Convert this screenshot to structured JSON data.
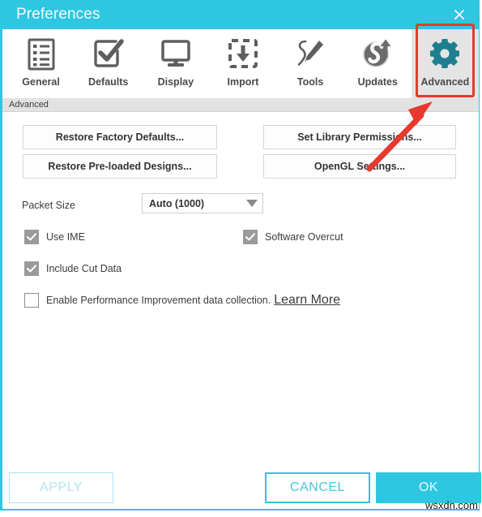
{
  "window": {
    "title": "Preferences",
    "close_icon": "close-icon",
    "accent_color": "#2ec6e0",
    "annotation_color": "#e8392f"
  },
  "toolbar": {
    "tabs": [
      {
        "label": "General",
        "icon": "list-document-icon",
        "active": false
      },
      {
        "label": "Defaults",
        "icon": "checkbox-checked-icon",
        "active": false
      },
      {
        "label": "Display",
        "icon": "monitor-icon",
        "active": false
      },
      {
        "label": "Import",
        "icon": "import-download-icon",
        "active": false
      },
      {
        "label": "Tools",
        "icon": "pencil-tool-icon",
        "active": false
      },
      {
        "label": "Updates",
        "icon": "updates-s-arrow-icon",
        "active": false
      },
      {
        "label": "Advanced",
        "icon": "gear-icon",
        "active": true
      }
    ]
  },
  "breadcrumb": {
    "text": "Advanced"
  },
  "content": {
    "buttons": [
      {
        "label": "Restore Factory Defaults...",
        "name": "restore-factory-defaults-button"
      },
      {
        "label": "Restore Pre-loaded Designs...",
        "name": "restore-preloaded-designs-button"
      },
      {
        "label": "Set Library Permissions...",
        "name": "set-library-permissions-button"
      },
      {
        "label": "OpenGL Settings...",
        "name": "opengl-settings-button"
      }
    ],
    "packet_size": {
      "label": "Packet Size",
      "value": "Auto (1000)",
      "arrow_icon": "chevron-down-icon"
    },
    "checkboxes": [
      {
        "label": "Use IME",
        "checked": true,
        "name": "use-ime-checkbox"
      },
      {
        "label": "Software Overcut",
        "checked": true,
        "name": "software-overcut-checkbox"
      },
      {
        "label": "Include Cut Data",
        "checked": true,
        "name": "include-cut-data-checkbox"
      }
    ],
    "performance": {
      "checked": false,
      "label": "Enable Performance Improvement data collection.",
      "link_text": "Learn More"
    }
  },
  "footer": {
    "apply_label": "APPLY",
    "cancel_label": "CANCEL",
    "ok_label": "OK"
  },
  "watermark": {
    "text": "wsxdn.com"
  }
}
